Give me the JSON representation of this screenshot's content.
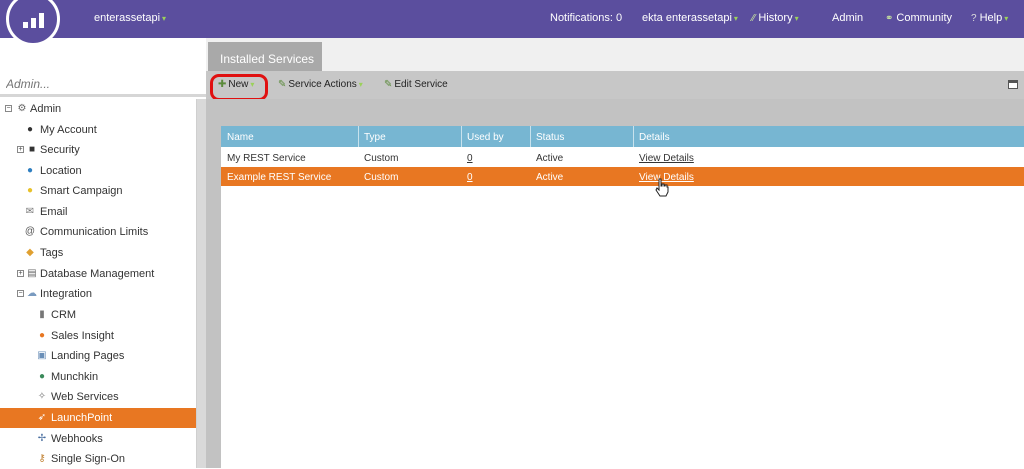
{
  "topbar": {
    "workspace": "enterassetapi",
    "notifications": "Notifications: 0",
    "user": "ekta enterassetapi",
    "history": "History",
    "admin": "Admin",
    "community": "Community",
    "help": "Help"
  },
  "search": {
    "placeholder": "Admin..."
  },
  "tabs": [
    {
      "label": "Installed Services"
    }
  ],
  "toolbar": {
    "new_label": "New",
    "service_actions_label": "Service Actions",
    "edit_service_label": "Edit Service"
  },
  "grid": {
    "columns": [
      "Name",
      "Type",
      "Used by",
      "Status",
      "Details"
    ],
    "rows": [
      {
        "name": "My REST Service",
        "type": "Custom",
        "used_by": "0",
        "status": "Active",
        "details": "View Details",
        "selected": false
      },
      {
        "name": "Example REST Service",
        "type": "Custom",
        "used_by": "0",
        "status": "Active",
        "details": "View Details",
        "selected": true
      }
    ]
  },
  "nav": {
    "items": [
      {
        "label": "Admin",
        "icon": "gear-icon",
        "expander": "minus"
      },
      {
        "label": "My Account",
        "icon": "person-icon"
      },
      {
        "label": "Security",
        "icon": "lock-icon",
        "expander": "plus"
      },
      {
        "label": "Location",
        "icon": "globe-icon"
      },
      {
        "label": "Smart Campaign",
        "icon": "lightbulb-icon"
      },
      {
        "label": "Email",
        "icon": "email-icon"
      },
      {
        "label": "Communication Limits",
        "icon": "at-icon"
      },
      {
        "label": "Tags",
        "icon": "tag-icon"
      },
      {
        "label": "Database Management",
        "icon": "database-icon",
        "expander": "plus"
      },
      {
        "label": "Integration",
        "icon": "cloud-icon",
        "expander": "minus"
      },
      {
        "label": "CRM",
        "icon": "crm-icon"
      },
      {
        "label": "Sales Insight",
        "icon": "sales-insight-icon"
      },
      {
        "label": "Landing Pages",
        "icon": "landing-page-icon"
      },
      {
        "label": "Munchkin",
        "icon": "munchkin-icon"
      },
      {
        "label": "Web Services",
        "icon": "web-services-icon"
      },
      {
        "label": "LaunchPoint",
        "icon": "rocket-icon",
        "active": true
      },
      {
        "label": "Webhooks",
        "icon": "webhook-icon"
      },
      {
        "label": "Single Sign-On",
        "icon": "key-icon"
      }
    ]
  },
  "colors": {
    "topbar": "#5b4e9e",
    "accent_orange": "#e87722",
    "grid_header": "#77b6d2",
    "highlight_red": "#e01010"
  }
}
